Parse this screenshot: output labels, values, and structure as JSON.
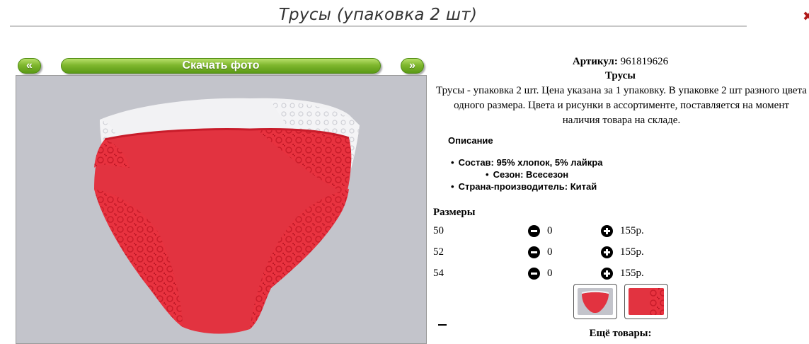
{
  "page": {
    "title": "Трусы (упаковка 2 шт)"
  },
  "nav": {
    "prev_label": "«",
    "download_label": "Скачать фото",
    "next_label": "»"
  },
  "product": {
    "article_label": "Артикул:",
    "article_value": "961819626",
    "name": "Трусы",
    "description": "Трусы - упаковка 2 шт. Цена указана за 1 упаковку. В упаковке 2 шт разного цвета одного размера. Цвета и рисунки в ассортименте, поставляется на момент наличия товара на складе."
  },
  "description_section": {
    "heading": "Описание",
    "items": [
      "Состав: 95% хлопок, 5% лайкра",
      "Сезон: Всесезон",
      "Страна-производитель: Китай"
    ]
  },
  "sizes": {
    "heading": "Размеры",
    "rows": [
      {
        "size": "50",
        "qty": "0",
        "price": "155р."
      },
      {
        "size": "52",
        "qty": "0",
        "price": "155р."
      },
      {
        "size": "54",
        "qty": "0",
        "price": "155р."
      }
    ]
  },
  "more": {
    "label": "Ещё товары:"
  },
  "colors": {
    "accent_green": "#7fb72e",
    "product_red": "#e23340",
    "photo_bg": "#c3c4cb"
  }
}
